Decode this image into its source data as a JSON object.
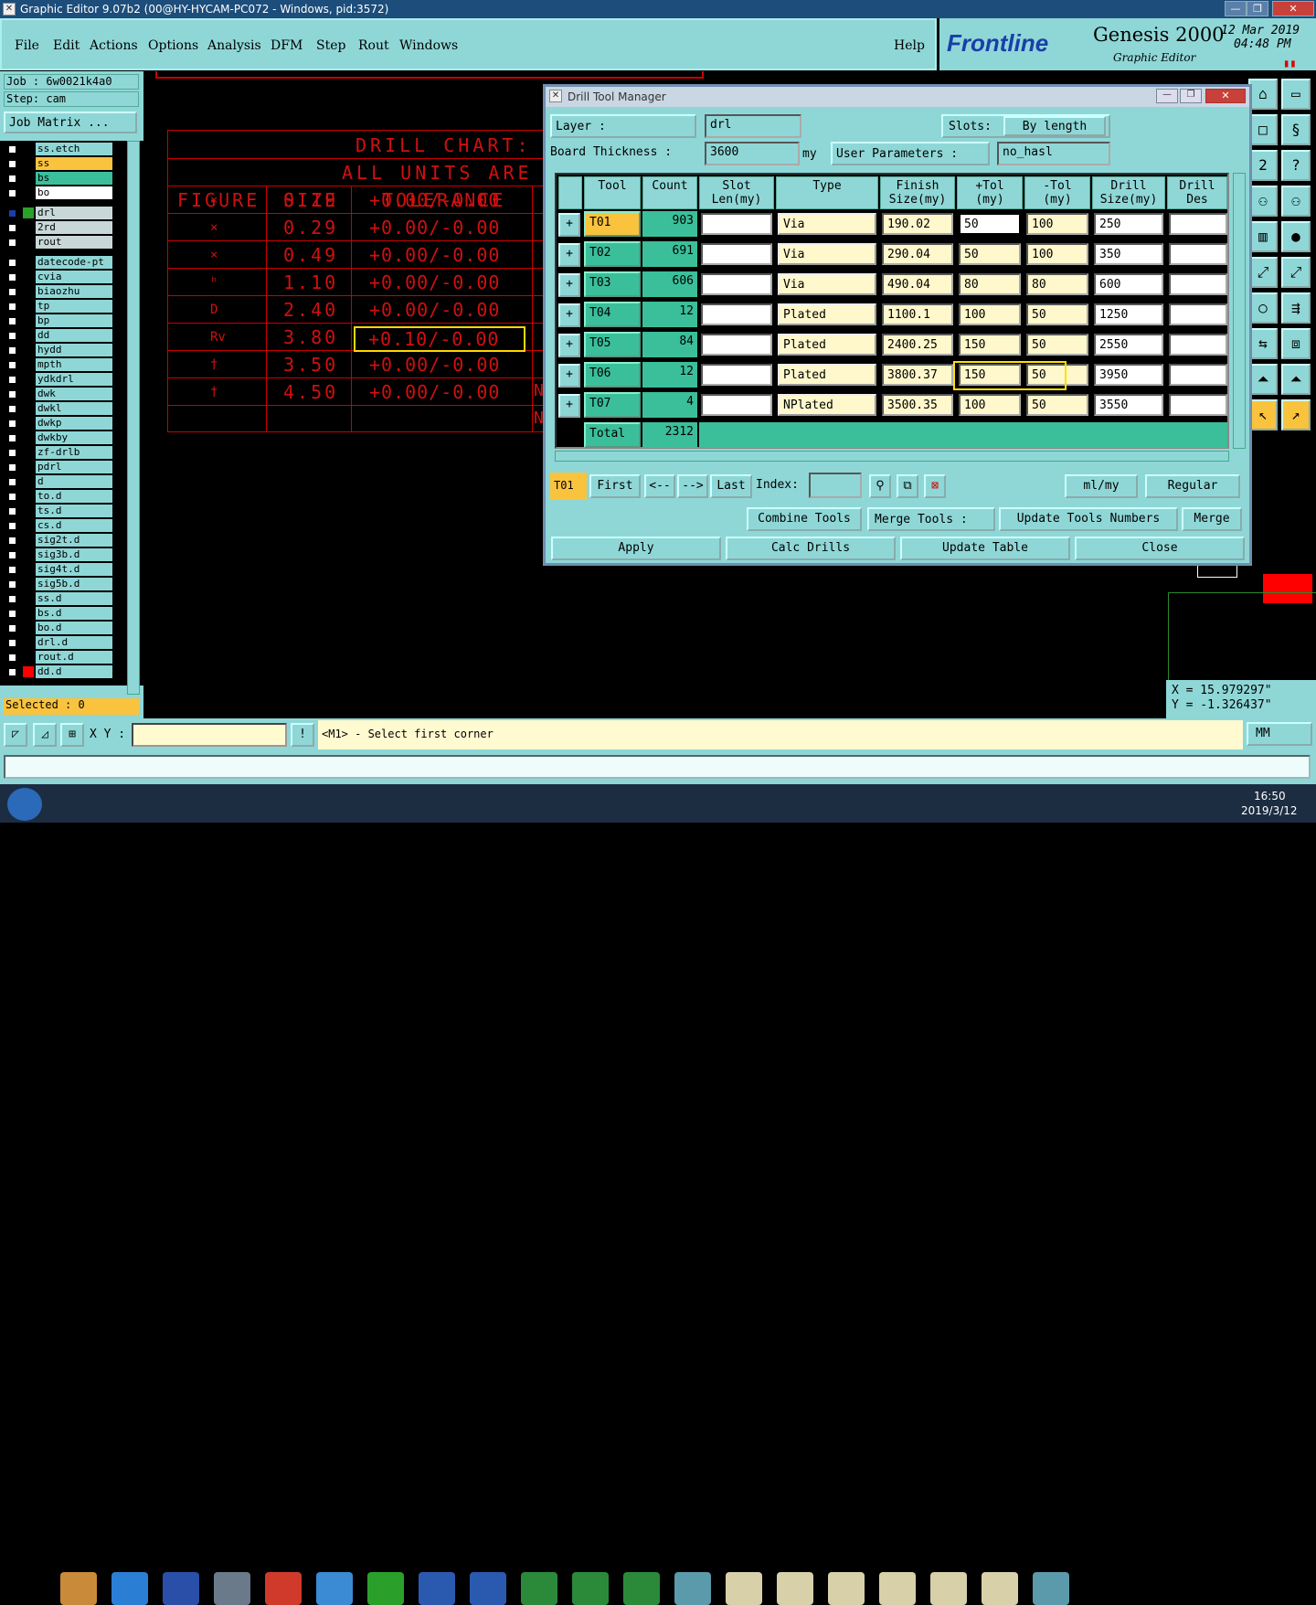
{
  "window": {
    "title": "Graphic Editor 9.07b2 (00@HY-HYCAM-PC072 - Windows, pid:3572)"
  },
  "menu": [
    "File",
    "Edit",
    "Actions",
    "Options",
    "Analysis",
    "DFM",
    "Step",
    "Rout",
    "Windows"
  ],
  "help": "Help",
  "brand": {
    "logo": "Frontline",
    "product": "Genesis 2000",
    "sub": "Graphic Editor",
    "date": "12 Mar 2019",
    "time": "04:48 PM"
  },
  "left": {
    "job": "Job  : 6w0021k4a0",
    "step": "Step: cam",
    "job_matrix": "Job Matrix ...",
    "selected": "Selected : 0",
    "layers": [
      "ss.etch",
      "ss",
      "bs",
      "bo",
      "drl",
      "2rd",
      "rout",
      "datecode-pt",
      "cvia",
      "biaozhu",
      "tp",
      "bp",
      "dd",
      "hydd",
      "mpth",
      "ydkdrl",
      "dwk",
      "dwkl",
      "dwkp",
      "dwkby",
      "zf-drlb",
      "pdrl",
      "d",
      "to.d",
      "ts.d",
      "cs.d",
      "sig2t.d",
      "sig3b.d",
      "sig4t.d",
      "sig5b.d",
      "ss.d",
      "bs.d",
      "bo.d",
      "drl.d",
      "rout.d",
      "dd.d"
    ]
  },
  "chart": {
    "title1": "DRILL CHART: T",
    "title2": "ALL UNITS ARE I",
    "cols": [
      "FIGURE",
      "SIZE",
      "TOLERANCE"
    ],
    "rows": [
      [
        "⨯",
        "0.19",
        "+0.00/-0.00"
      ],
      [
        "⨯",
        "0.29",
        "+0.00/-0.00"
      ],
      [
        "⨯",
        "0.49",
        "+0.00/-0.00"
      ],
      [
        "ʰ",
        "1.10",
        "+0.00/-0.00"
      ],
      [
        "D",
        "2.40",
        "+0.00/-0.00"
      ],
      [
        "Rv",
        "3.80",
        "+0.10/-0.00"
      ],
      [
        "†",
        "3.50",
        "+0.00/-0.00"
      ],
      [
        "†",
        "4.50",
        "+0.00/-0.00"
      ]
    ],
    "trail": [
      "N",
      "N"
    ]
  },
  "dialog": {
    "title": "Drill Tool Manager",
    "layer_label": "Layer          :",
    "layer": "drl",
    "slots_label": "Slots:",
    "slots": "By length",
    "thick_label": "Board Thickness :",
    "thick": "3600",
    "my": "my",
    "user_params_label": "User Parameters :",
    "user_params": "no_hasl",
    "headers": [
      "Tool",
      "Count",
      "Slot\nLen(my)",
      "Type",
      "Finish\nSize(my)",
      "+Tol\n(my)",
      "-Tol\n(my)",
      "Drill\nSize(my)",
      "Drill\nDes"
    ],
    "rows": [
      {
        "tool": "T01",
        "count": "903",
        "type": "Via",
        "finish": "190.02",
        "ptol": "50",
        "mtol": "100",
        "drill": "250"
      },
      {
        "tool": "T02",
        "count": "691",
        "type": "Via",
        "finish": "290.04",
        "ptol": "50",
        "mtol": "100",
        "drill": "350"
      },
      {
        "tool": "T03",
        "count": "606",
        "type": "Via",
        "finish": "490.04",
        "ptol": "80",
        "mtol": "80",
        "drill": "600"
      },
      {
        "tool": "T04",
        "count": "12",
        "type": "Plated",
        "finish": "1100.1",
        "ptol": "100",
        "mtol": "50",
        "drill": "1250"
      },
      {
        "tool": "T05",
        "count": "84",
        "type": "Plated",
        "finish": "2400.25",
        "ptol": "150",
        "mtol": "50",
        "drill": "2550"
      },
      {
        "tool": "T06",
        "count": "12",
        "type": "Plated",
        "finish": "3800.37",
        "ptol": "150",
        "mtol": "50",
        "drill": "3950"
      },
      {
        "tool": "T07",
        "count": "4",
        "type": "NPlated",
        "finish": "3500.35",
        "ptol": "100",
        "mtol": "50",
        "drill": "3550"
      }
    ],
    "total_label": "Total",
    "total": "2312",
    "nav": {
      "current": "T01",
      "first": "First",
      "prev": "<--",
      "next": "-->",
      "last": "Last",
      "index": "Index:",
      "units": "ml/my",
      "mode": "Regular"
    },
    "combine": "Combine Tools",
    "merge_label": "Merge Tools  :",
    "update_nums": "Update Tools Numbers",
    "merge": "Merge",
    "apply": "Apply",
    "calc": "Calc Drills",
    "update_table": "Update Table",
    "close": "Close"
  },
  "status": {
    "xy_label": "X Y :",
    "prompt": "<M1> - Select first corner",
    "units": "MM",
    "x": "X = 15.979297\"",
    "y": "Y = -1.326437\""
  },
  "taskbar": {
    "time": "16:50",
    "date": "2019/3/12"
  }
}
